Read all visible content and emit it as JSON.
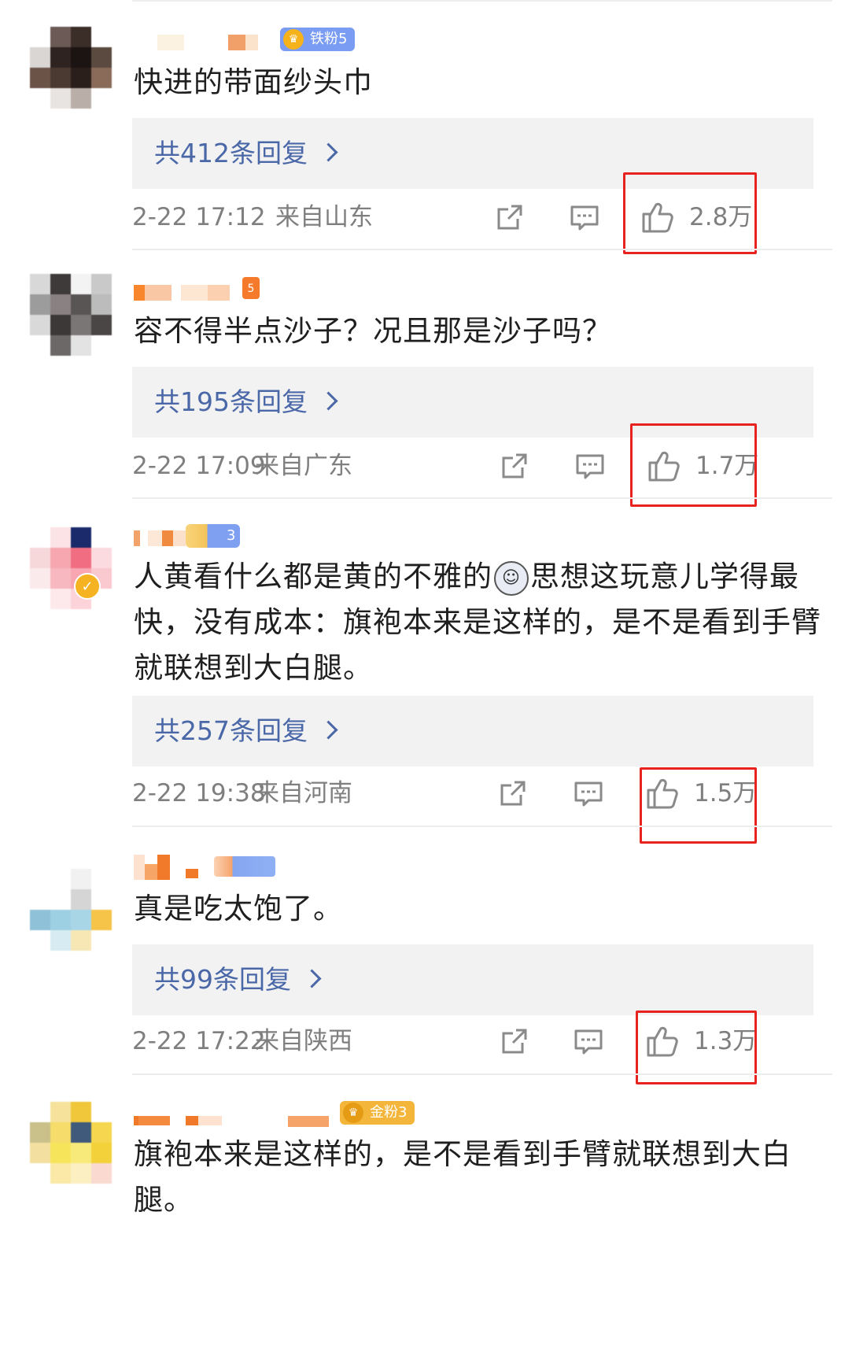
{
  "comments": [
    {
      "badge": "铁粉5",
      "text": "快进的带面纱头巾",
      "replies": "共412条回复",
      "time": "2-22 17:12",
      "location": "来自山东",
      "likes": "2.8万"
    },
    {
      "badge": "5",
      "text": "容不得半点沙子？况且那是沙子吗？",
      "replies": "共195条回复",
      "time": "2-22 17:09",
      "location": "来自广东",
      "likes": "1.7万"
    },
    {
      "badge": "3",
      "text_part1": "人黄看什么都是黄的不雅的",
      "text_part2": "思想这玩意儿学得最快，没有成本：旗袍本来是这样的，是不是看到手臂就联想到大白腿。",
      "replies": "共257条回复",
      "time": "2-22 19:38",
      "location": "来自河南",
      "likes": "1.5万"
    },
    {
      "text": "真是吃太饱了。",
      "replies": "共99条回复",
      "time": "2-22 17:22",
      "location": "来自陕西",
      "likes": "1.3万"
    },
    {
      "badge": "金粉3",
      "text": "旗袍本来是这样的，是不是看到手臂就联想到大白腿。"
    }
  ],
  "colors": {
    "link_blue": "#4a67a8",
    "meta_gray": "#7f7f7f",
    "highlight_red": "#e8231f",
    "reply_bg": "#f2f2f2"
  },
  "icons": [
    "share-icon",
    "comment-icon",
    "like-icon",
    "crown-icon",
    "fire-icon",
    "emoji-icon",
    "verified-icon",
    "chevron-right-icon"
  ]
}
